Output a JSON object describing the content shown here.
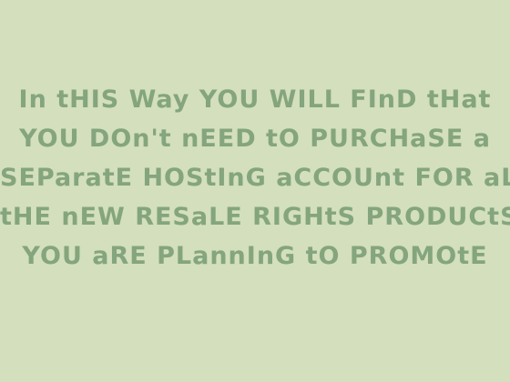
{
  "slide": {
    "background_color": "#d3dfbd",
    "text_color": "#84a57d",
    "lines": [
      "In tHIS Way YOU WILL FInD tHat",
      "YOU DOn't nEED tO PURCHaSE a",
      "SEParatE HOStInG aCCOUnt FOR aLL",
      "tHE nEW RESaLE RIGHtS PRODUCtS",
      "YOU aRE PLannInG tO PROMOtE"
    ]
  }
}
